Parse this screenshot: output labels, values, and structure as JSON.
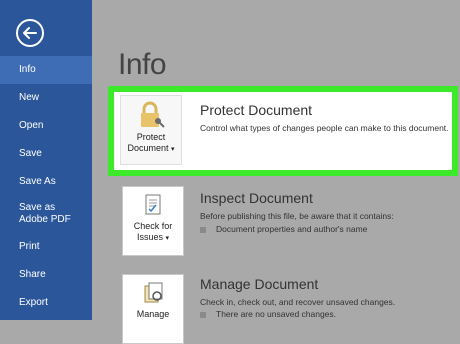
{
  "sidebar": {
    "back_icon": "back-arrow-icon",
    "items": [
      {
        "label": "Info",
        "selected": true
      },
      {
        "label": "New"
      },
      {
        "label": "Open"
      },
      {
        "label": "Save"
      },
      {
        "label": "Save As"
      },
      {
        "label": "Save as Adobe PDF"
      },
      {
        "label": "Print"
      },
      {
        "label": "Share"
      },
      {
        "label": "Export"
      }
    ]
  },
  "main": {
    "title": "Info",
    "sections": [
      {
        "tile_label_line1": "Protect",
        "tile_label_line2": "Document",
        "heading": "Protect Document",
        "description": "Control what types of changes people can make to this document."
      },
      {
        "tile_label_line1": "Check for",
        "tile_label_line2": "Issues",
        "heading": "Inspect Document",
        "description": "Before publishing this file, be aware that it contains:",
        "bullets": [
          "Document properties and author's name"
        ]
      },
      {
        "tile_label_line1": "Manage",
        "tile_label_line2": "",
        "heading": "Manage Document",
        "description": "Check in, check out, and recover unsaved changes.",
        "bullets": [
          "There are no unsaved changes."
        ]
      }
    ]
  },
  "colors": {
    "sidebar": "#2b579a",
    "sidebar_selected": "#3e6db5",
    "highlight": "#3dea2a",
    "background": "#a9a9a9"
  }
}
